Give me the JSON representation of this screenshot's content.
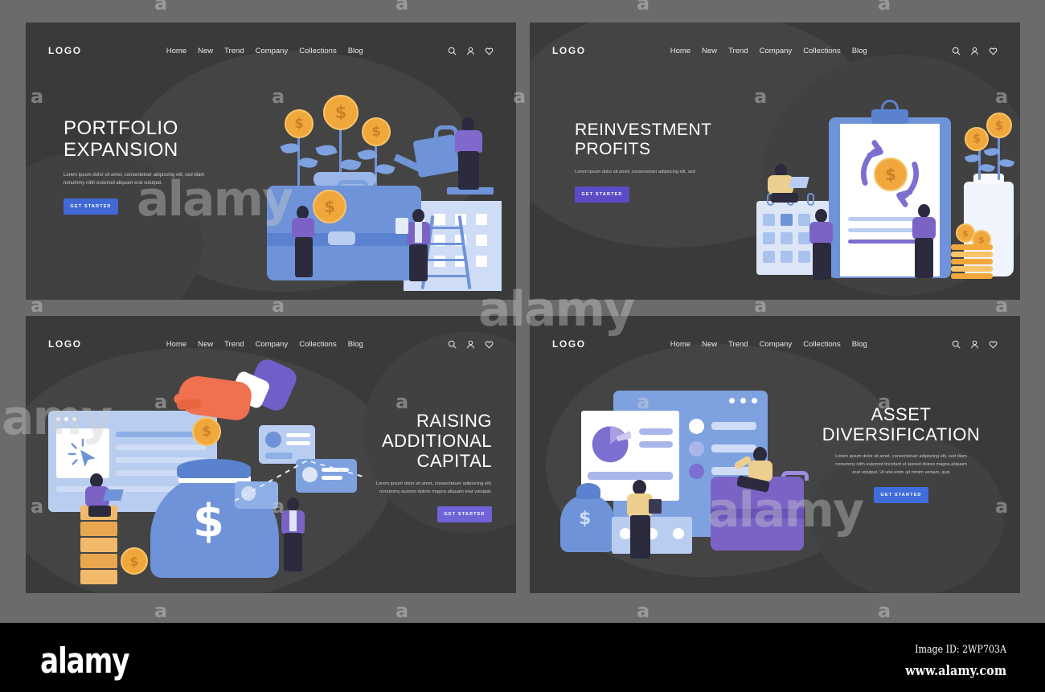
{
  "meta": {
    "background_color": "#6b6b6b",
    "panel_color": "#3a3a3a"
  },
  "watermark": {
    "letter": "a",
    "word": "alamy"
  },
  "nav": {
    "logo": "LOGO",
    "links": [
      "Home",
      "New",
      "Trend",
      "Company",
      "Collections",
      "Blog"
    ],
    "icons": [
      "search-icon",
      "user-icon",
      "heart-icon"
    ]
  },
  "panels": [
    {
      "id": "portfolio-expansion",
      "title_lines": [
        "PORTFOLIO",
        "EXPANSION"
      ],
      "body": "Lorem ipsum dolor sit amet, consectetuer adipiscing elit, sed diam nonummy nibh euismod aliquam erat volutpat.",
      "cta": "GET STARTED",
      "cta_color": "#4169d6",
      "align": "left",
      "illustration": "briefcase-money-plants-watering"
    },
    {
      "id": "reinvestment-profits",
      "title_lines": [
        "REINVESTMENT",
        "PROFITS"
      ],
      "body": "Lorem ipsum dolor sit amet, consectetuer adipiscing elit, sed",
      "cta": "GET STARTED",
      "cta_color": "#5a4cc4",
      "align": "left",
      "illustration": "clipboard-recycle-dollar-calendar-jar"
    },
    {
      "id": "raising-additional-capital",
      "title_lines": [
        "RAISING",
        "ADDITIONAL",
        "CAPITAL"
      ],
      "body": "Lorem ipsum dolor sit amet, consectetuer adipiscing elit, nonummy euismo dolore magna aliquam erat volutpat.",
      "cta": "GET STARTED",
      "cta_color": "#6f63d8",
      "align": "right",
      "illustration": "money-bag-hand-coin-browser"
    },
    {
      "id": "asset-diversification",
      "title_lines": [
        "ASSET",
        "DIVERSIFICATION"
      ],
      "body": "Lorem ipsum dolor sit amet, consectetuer adipiscing elit, sed diam nonummy nibh euismod tincidunt ut laoreet dolore magna aliquam erat volutpat. Ut wisi enim ad minim veniam, quis",
      "cta": "GET STARTED",
      "cta_color": "#3f6ddb",
      "align": "center",
      "illustration": "pie-chart-presentation-briefcase"
    }
  ],
  "footer": {
    "logo": "alamy",
    "image_id": "Image ID: 2WP703A",
    "url": "www.alamy.com",
    "background": "#000000"
  }
}
